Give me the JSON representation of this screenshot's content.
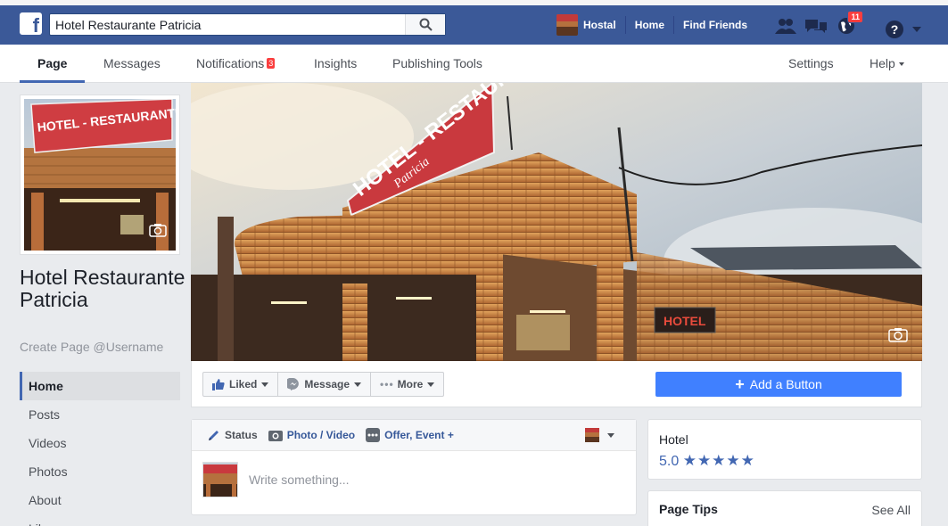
{
  "topbar": {
    "search_value": "Hotel Restaurante Patricia",
    "search_placeholder": "Search",
    "user_name": "Hostal",
    "home_label": "Home",
    "find_friends_label": "Find Friends",
    "messages_badge": "",
    "notifications_badge": "11"
  },
  "tabs": {
    "page": "Page",
    "messages": "Messages",
    "notifications": "Notifications",
    "notifications_count": "3",
    "insights": "Insights",
    "publishing_tools": "Publishing Tools",
    "settings": "Settings",
    "help": "Help"
  },
  "profile": {
    "name": "Hotel Restaurante Patricia",
    "username_link": "Create Page @Username",
    "sign_text": "HOTEL - RESTAURANTE"
  },
  "leftnav": {
    "items": [
      "Home",
      "Posts",
      "Videos",
      "Photos",
      "About",
      "Likes"
    ]
  },
  "cover": {
    "sign_text": "HOTEL - RESTAURANTE",
    "sign_sub": "Patricia",
    "hotel_sign": "HOTEL"
  },
  "actions": {
    "liked": "Liked",
    "message": "Message",
    "more": "More",
    "add_button": "Add a Button"
  },
  "composer": {
    "status": "Status",
    "photo_video": "Photo / Video",
    "offer_event": "Offer, Event +",
    "placeholder": "Write something..."
  },
  "hotel_card": {
    "category": "Hotel",
    "rating": "5.0",
    "stars": "★★★★★"
  },
  "tips_card": {
    "title": "Page Tips",
    "see_all": "See All"
  },
  "colors": {
    "brand_blue": "#3b5998",
    "accent_blue": "#4080ff",
    "badge_red": "#fa3e3e"
  }
}
